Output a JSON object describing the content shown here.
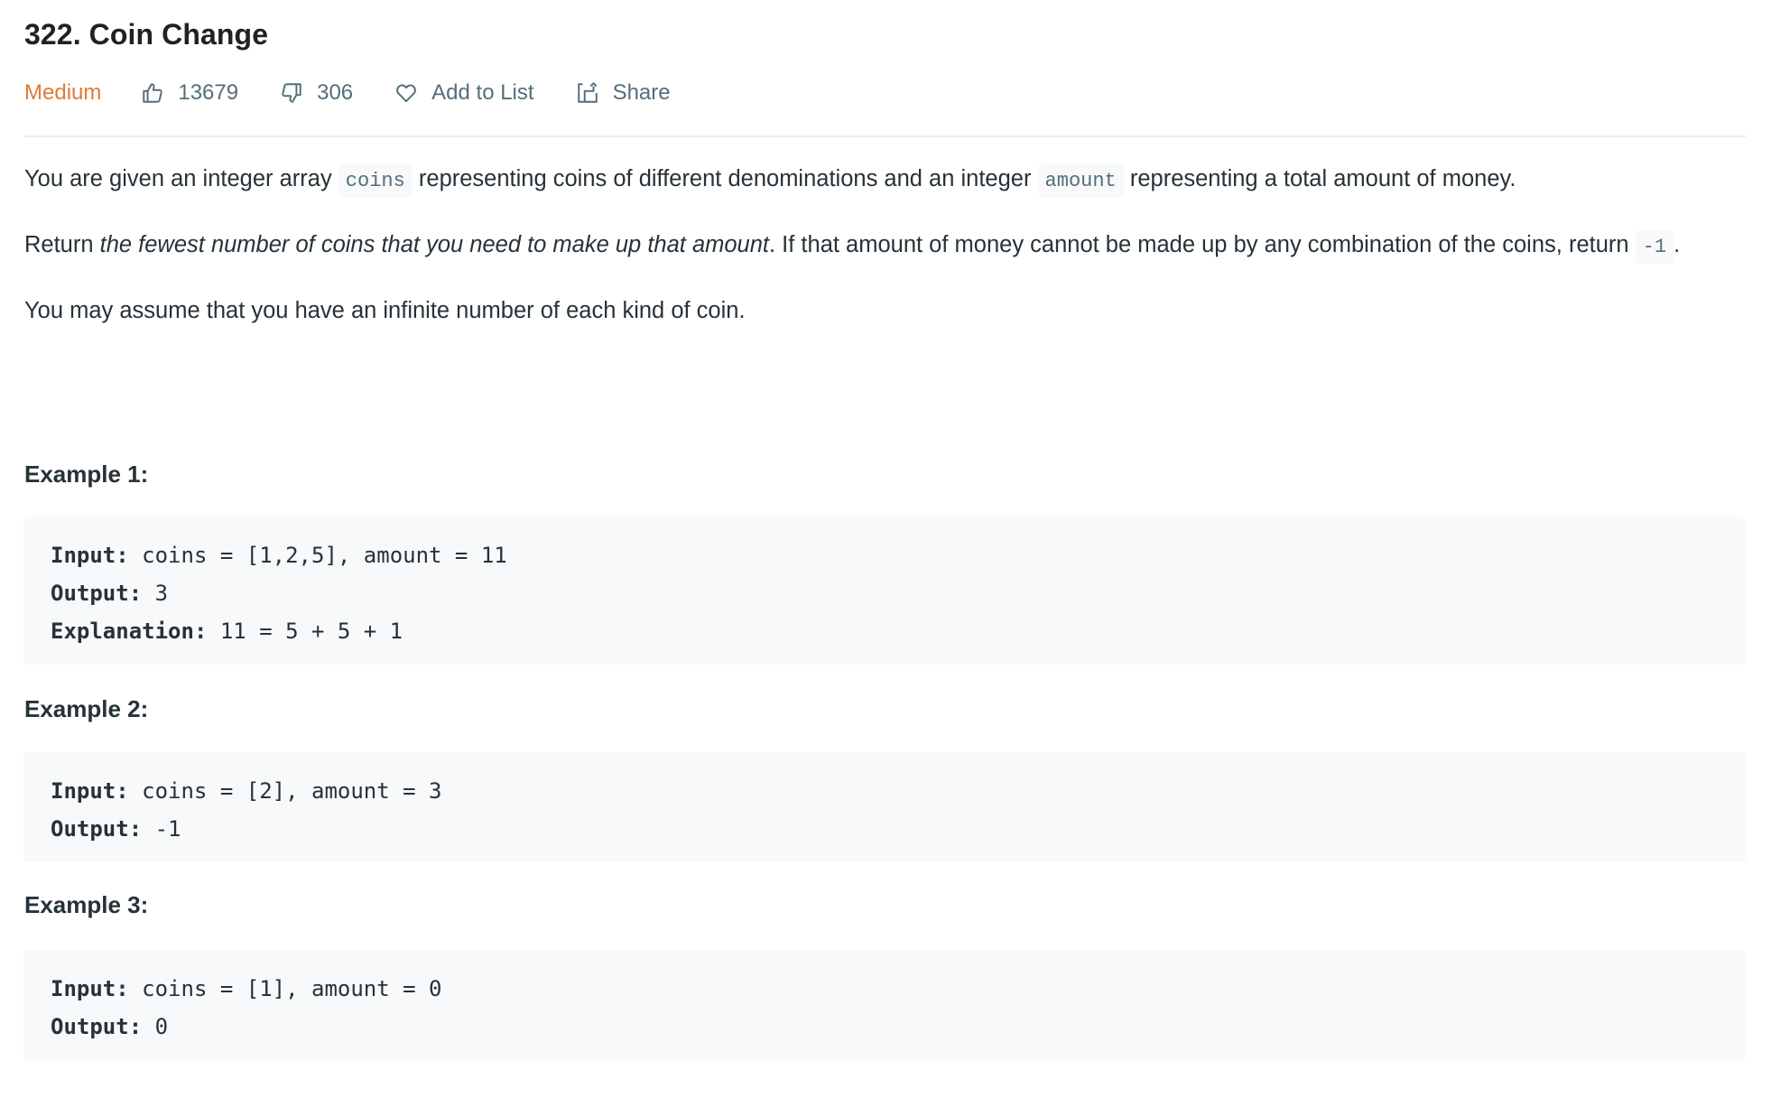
{
  "problem": {
    "title": "322. Coin Change",
    "difficulty": "Medium",
    "difficulty_color": "#e07a34",
    "likes": "13679",
    "dislikes": "306",
    "add_to_list_label": "Add to List",
    "share_label": "Share",
    "icons": {
      "like": "thumbs-up-icon",
      "dislike": "thumbs-down-icon",
      "add_to_list": "heart-icon",
      "share": "share-icon"
    }
  },
  "description": {
    "p1": {
      "t1": "You are given an integer array ",
      "code1": "coins",
      "t2": " representing coins of different denominations and an integer ",
      "code2": "amount",
      "t3": " representing a total amount of money."
    },
    "p2": {
      "t1": "Return ",
      "em": "the fewest number of coins that you need to make up that amount",
      "t2": ". If that amount of money cannot be made up by any combination of the coins, return ",
      "code": "-1",
      "t3": "."
    },
    "p3": "You may assume that you have an infinite number of each kind of coin."
  },
  "examples": [
    {
      "heading": "Example 1:",
      "lines": [
        {
          "label": "Input:",
          "value": " coins = [1,2,5], amount = 11"
        },
        {
          "label": "Output:",
          "value": " 3"
        },
        {
          "label": "Explanation:",
          "value": " 11 = 5 + 5 + 1"
        }
      ]
    },
    {
      "heading": "Example 2:",
      "lines": [
        {
          "label": "Input:",
          "value": " coins = [2], amount = 3"
        },
        {
          "label": "Output:",
          "value": " -1"
        }
      ]
    },
    {
      "heading": "Example 3:",
      "lines": [
        {
          "label": "Input:",
          "value": " coins = [1], amount = 0"
        },
        {
          "label": "Output:",
          "value": " 0"
        }
      ]
    }
  ]
}
